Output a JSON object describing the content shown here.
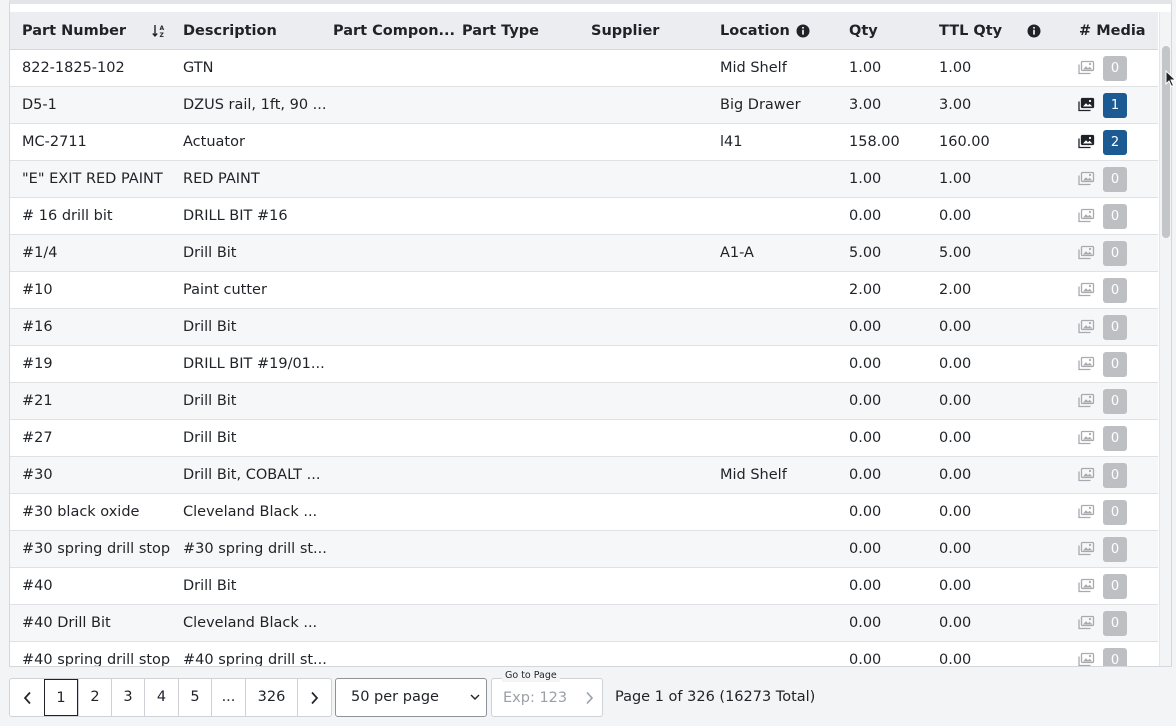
{
  "columns": [
    {
      "key": "part_number",
      "label": "Part Number"
    },
    {
      "key": "description",
      "label": "Description"
    },
    {
      "key": "part_component",
      "label": "Part Compon..."
    },
    {
      "key": "part_type",
      "label": "Part Type"
    },
    {
      "key": "supplier",
      "label": "Supplier"
    },
    {
      "key": "location",
      "label": "Location"
    },
    {
      "key": "qty",
      "label": "Qty"
    },
    {
      "key": "ttl_qty",
      "label": "TTL Qty"
    },
    {
      "key": "media",
      "label": "# Media"
    }
  ],
  "rows": [
    {
      "part_number": "822-1825-102",
      "description": "GTN",
      "location": "Mid Shelf",
      "qty": "1.00",
      "ttl_qty": "1.00",
      "media": "0"
    },
    {
      "part_number": "D5-1",
      "description": "DZUS rail, 1ft, 90 ...",
      "location": "Big Drawer",
      "qty": "3.00",
      "ttl_qty": "3.00",
      "media": "1"
    },
    {
      "part_number": "MC-2711",
      "description": "Actuator",
      "location": "l41",
      "qty": "158.00",
      "ttl_qty": "160.00",
      "media": "2"
    },
    {
      "part_number": "\"E\" EXIT RED PAINT",
      "description": "RED PAINT",
      "location": "",
      "qty": "1.00",
      "ttl_qty": "1.00",
      "media": "0"
    },
    {
      "part_number": "# 16 drill bit",
      "description": "DRILL BIT #16",
      "location": "",
      "qty": "0.00",
      "ttl_qty": "0.00",
      "media": "0"
    },
    {
      "part_number": "#1/4",
      "description": "Drill Bit",
      "location": "A1-A",
      "qty": "5.00",
      "ttl_qty": "5.00",
      "media": "0"
    },
    {
      "part_number": "#10",
      "description": "Paint cutter",
      "location": "",
      "qty": "2.00",
      "ttl_qty": "2.00",
      "media": "0"
    },
    {
      "part_number": "#16",
      "description": "Drill Bit",
      "location": "",
      "qty": "0.00",
      "ttl_qty": "0.00",
      "media": "0"
    },
    {
      "part_number": "#19",
      "description": "DRILL BIT #19/01...",
      "location": "",
      "qty": "0.00",
      "ttl_qty": "0.00",
      "media": "0"
    },
    {
      "part_number": "#21",
      "description": "Drill Bit",
      "location": "",
      "qty": "0.00",
      "ttl_qty": "0.00",
      "media": "0"
    },
    {
      "part_number": "#27",
      "description": "Drill Bit",
      "location": "",
      "qty": "0.00",
      "ttl_qty": "0.00",
      "media": "0"
    },
    {
      "part_number": "#30",
      "description": "Drill Bit, COBALT ...",
      "location": "Mid Shelf",
      "qty": "0.00",
      "ttl_qty": "0.00",
      "media": "0"
    },
    {
      "part_number": "#30 black oxide",
      "description": "Cleveland Black ...",
      "location": "",
      "qty": "0.00",
      "ttl_qty": "0.00",
      "media": "0"
    },
    {
      "part_number": "#30 spring drill stop",
      "description": "#30 spring drill st...",
      "location": "",
      "qty": "0.00",
      "ttl_qty": "0.00",
      "media": "0"
    },
    {
      "part_number": "#40",
      "description": "Drill Bit",
      "location": "",
      "qty": "0.00",
      "ttl_qty": "0.00",
      "media": "0"
    },
    {
      "part_number": "#40 Drill Bit",
      "description": "Cleveland Black ...",
      "location": "",
      "qty": "0.00",
      "ttl_qty": "0.00",
      "media": "0"
    },
    {
      "part_number": "#40 spring drill stop",
      "description": "#40 spring drill st...",
      "location": "",
      "qty": "0.00",
      "ttl_qty": "0.00",
      "media": "0"
    }
  ],
  "pagination": {
    "pages": [
      "1",
      "2",
      "3",
      "4",
      "5",
      "...",
      "326"
    ],
    "current": "1",
    "per_page": "50 per page",
    "goto_label": "Go to Page",
    "goto_placeholder": "Exp: 123",
    "summary": "Page 1 of 326 (16273 Total)"
  },
  "colors": {
    "media_badge_active": "#1c5a94",
    "media_badge_inactive": "#bdbfc2",
    "header_bg": "#ebedf0"
  }
}
